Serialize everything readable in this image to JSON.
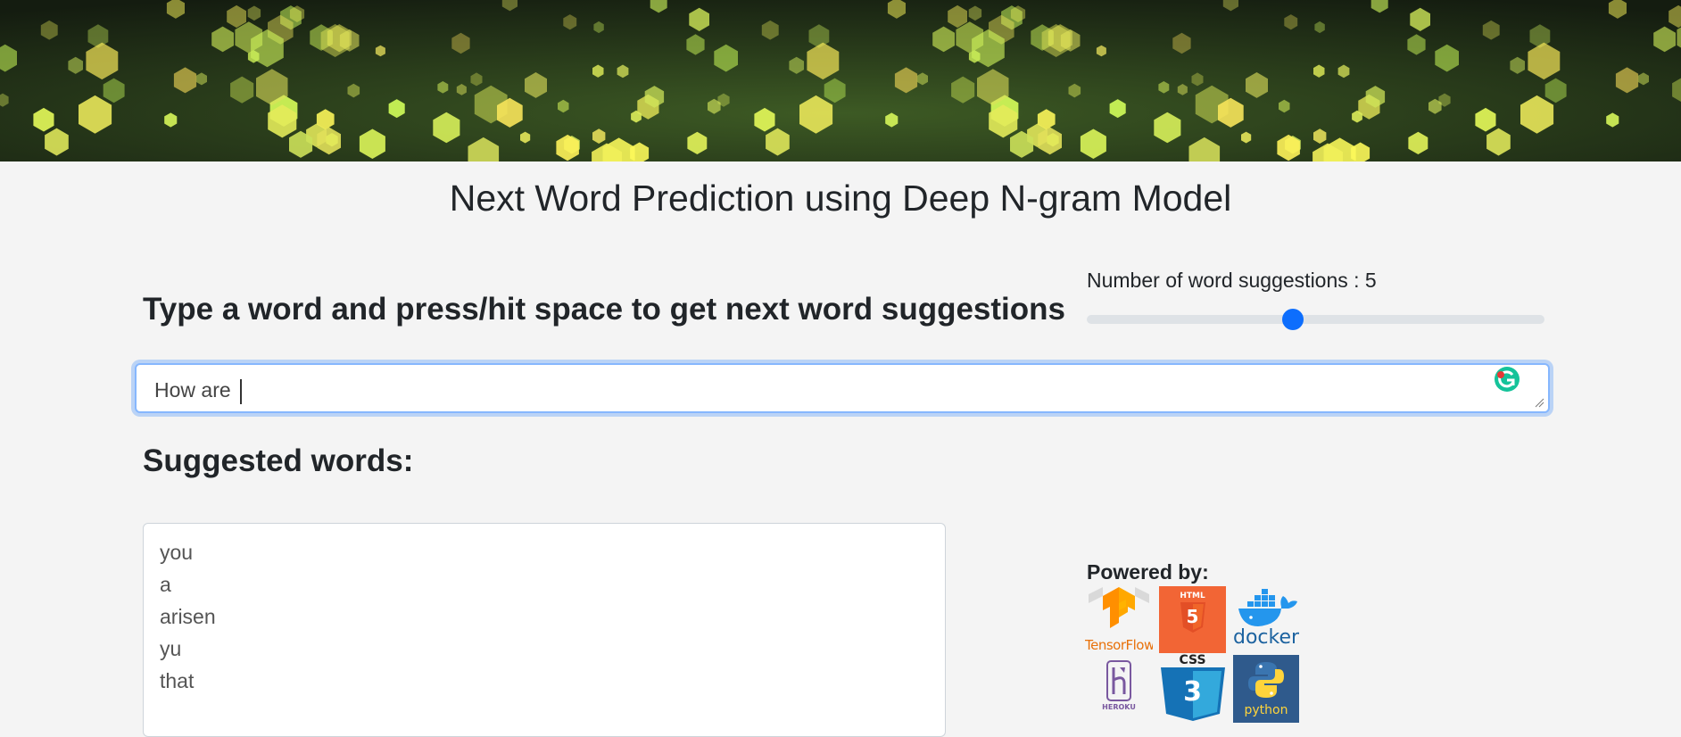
{
  "header": {
    "title": "Next Word Prediction using Deep N-gram Model"
  },
  "controls": {
    "instruction": "Type a word and press/hit space to get next word suggestions",
    "slider_label": "Number of word suggestions : 5",
    "slider_fraction": 0.45,
    "accent_color": "#0d6efd"
  },
  "input": {
    "value": "How are "
  },
  "suggestions": {
    "heading": "Suggested words:",
    "words": [
      "you",
      "a",
      "arisen",
      "yu",
      "that"
    ]
  },
  "powered_by": {
    "label": "Powered by:",
    "logos": {
      "tensorflow": "TensorFlow",
      "html5_top": "HTML",
      "html5_num": "5",
      "docker": "docker",
      "heroku": "HEROKU",
      "css3_top": "CSS",
      "css3_num": "3",
      "python": "python"
    }
  }
}
